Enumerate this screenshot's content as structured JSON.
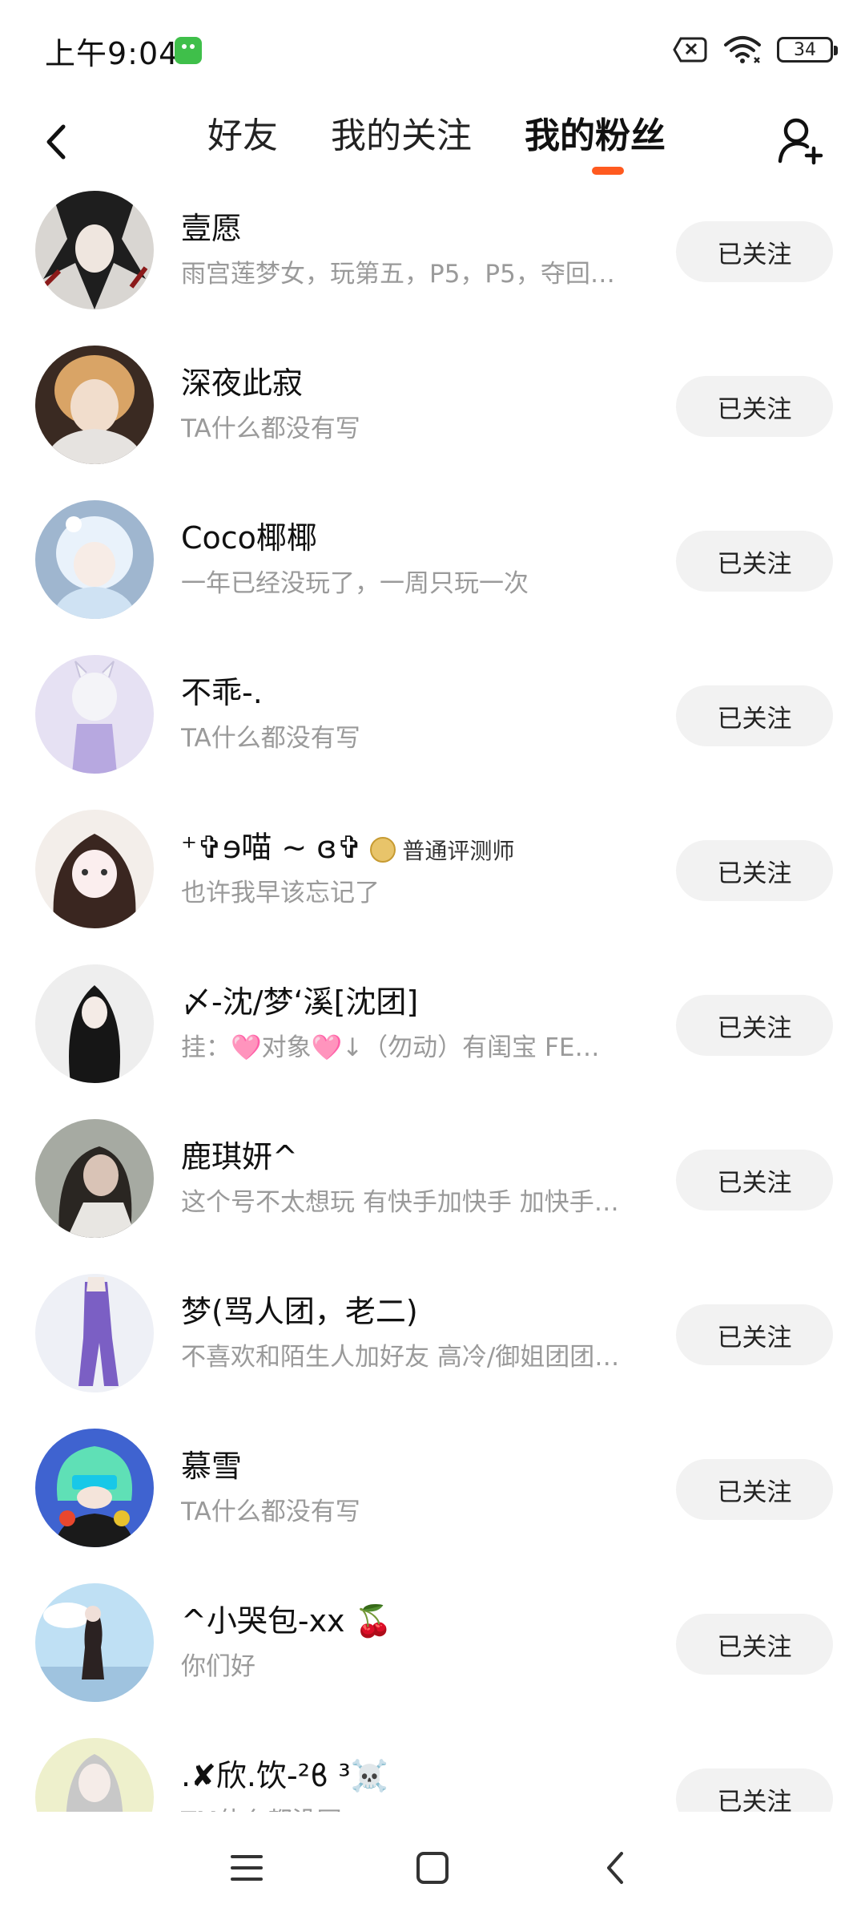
{
  "status_bar": {
    "time": "上午9:04",
    "battery": "34",
    "icons": [
      "app-notification-icon",
      "no-sim-icon",
      "wifi-icon",
      "battery-icon"
    ]
  },
  "header": {
    "tabs": [
      {
        "label": "好友",
        "active": false
      },
      {
        "label": "我的关注",
        "active": false
      },
      {
        "label": "我的粉丝",
        "active": true
      }
    ],
    "accent_color": "#ff5a1f"
  },
  "fans": [
    {
      "name": "壹愿",
      "bio": "雨宫莲梦女，玩第五，P5，P5，夺回…",
      "button": "已关注",
      "avatar_color": "#2b2b2b"
    },
    {
      "name": "深夜此寂",
      "bio": "TA什么都没有写",
      "button": "已关注",
      "avatar_color": "#c9a27a"
    },
    {
      "name": "Coco椰椰",
      "bio": "一年已经没玩了，一周只玩一次",
      "button": "已关注",
      "avatar_color": "#b9d4e8"
    },
    {
      "name": "不乖-.",
      "bio": "TA什么都没有写",
      "button": "已关注",
      "avatar_color": "#d9d0ee"
    },
    {
      "name": "⁺✞ɘ喵 ~ ɞ✞",
      "badge": "普通评测师",
      "bio": "也许我早该忘记了",
      "button": "已关注",
      "avatar_color": "#e8dcd6"
    },
    {
      "name": "〆-沈/梦‘溪[沈团]",
      "bio": "挂：🩷对象🩷↓（勿动）有闺宝 FE…",
      "button": "已关注",
      "avatar_color": "#e6e6e6"
    },
    {
      "name": "鹿琪妍^",
      "bio": "这个号不太想玩 有快手加快手 加快手…",
      "button": "已关注",
      "avatar_color": "#8a8f88"
    },
    {
      "name": "梦(骂人团，老二)",
      "bio": "不喜欢和陌生人加好友 高冷/御姐团团…",
      "button": "已关注",
      "avatar_color": "#e2e4ee"
    },
    {
      "name": "慕雪",
      "bio": "TA什么都没有写",
      "button": "已关注",
      "avatar_color": "#4a6fd6"
    },
    {
      "name": "^小哭包-xx 🍒",
      "bio": "你们好",
      "button": "已关注",
      "avatar_color": "#bfe0f2"
    },
    {
      "name": ".✘欣.饮-²ϐ ³☠️",
      "bio": "TM什么都没写",
      "button": "已关注",
      "avatar_color": "#e9ecc8"
    }
  ],
  "nav_bar": {
    "icons": [
      "menu-icon",
      "home-icon",
      "back-icon"
    ]
  }
}
